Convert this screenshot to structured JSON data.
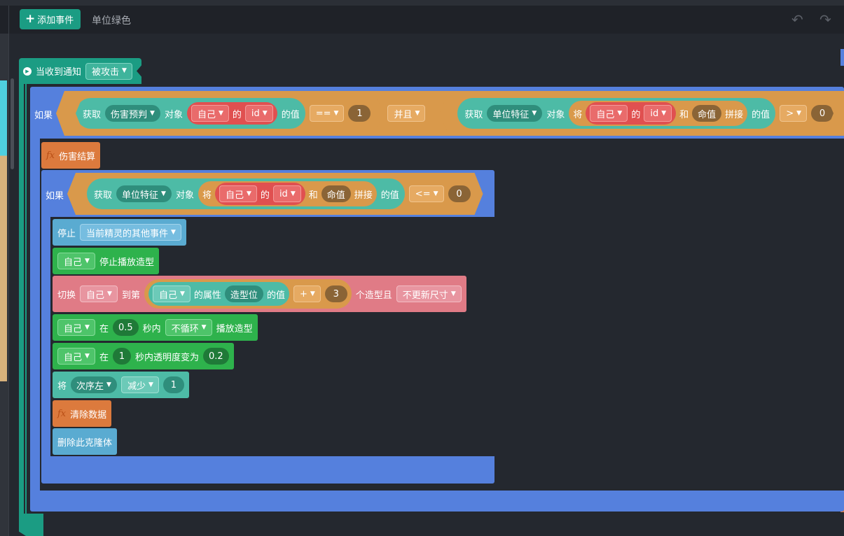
{
  "toolbar": {
    "add_event_label": "添加事件",
    "add_icon": "plus-icon",
    "tab_label": "单位绿色",
    "undo_icon": "undo-icon",
    "redo_icon": "redo-icon"
  },
  "colors": {
    "background": "#24282f",
    "toolbar": "#1f2228",
    "event_teal": "#1b9c83",
    "if_blue": "#5580dd",
    "operator_orange": "#d9994b",
    "sensing_teal": "#4dbba6",
    "self_red": "#e05050",
    "looks_green": "#2eb24c",
    "control_blue": "#5aabd1",
    "looks_pink": "#e07b86",
    "func_orange": "#dc7a3d"
  },
  "event": {
    "label": "当收到通知",
    "icon": "play-circle-icon",
    "message": "被攻击"
  },
  "if1": {
    "label": "如果",
    "get1": {
      "label": "获取",
      "prop": "伤害预判",
      "obj_label": "对象",
      "self": "自己",
      "of": "的",
      "field": "id",
      "value_label": "的值"
    },
    "cmp1": {
      "op": "==",
      "value": "1"
    },
    "and": "并且",
    "get2": {
      "label": "获取",
      "prop": "单位特征",
      "obj_label": "对象",
      "concat_prefix": "将",
      "self": "自己",
      "of": "的",
      "field": "id",
      "and": "和",
      "str": "命值",
      "concat": "拼接",
      "value_label": "的值"
    },
    "cmp2": {
      "op": ">",
      "value": "0"
    }
  },
  "func1": {
    "icon": "fx-icon",
    "label": "伤害结算"
  },
  "if2": {
    "label": "如果",
    "get": {
      "label": "获取",
      "prop": "单位特征",
      "obj_label": "对象",
      "concat_prefix": "将",
      "self": "自己",
      "of": "的",
      "field": "id",
      "and": "和",
      "str": "命值",
      "concat": "拼接",
      "value_label": "的值"
    },
    "cmp": {
      "op": "<=",
      "value": "0"
    }
  },
  "stop": {
    "label": "停止",
    "target": "当前精灵的其他事件"
  },
  "stop_anim": {
    "self": "自己",
    "label": "停止播放造型"
  },
  "switch": {
    "label": "切换",
    "self": "自己",
    "to": "到第",
    "self2": "自己",
    "attr": "的属性",
    "attr_name": "造型位",
    "value_label": "的值",
    "op": "+",
    "num": "3",
    "suffix": "个造型且",
    "mode": "不更新尺寸"
  },
  "play": {
    "self": "自己",
    "in": "在",
    "secs": "0.5",
    "secs_label": "秒内",
    "loop": "不循环",
    "label": "播放造型"
  },
  "fade": {
    "self": "自己",
    "in": "在",
    "secs": "1",
    "label": "秒内透明度变为",
    "value": "0.2"
  },
  "change": {
    "label": "将",
    "var": "次序左",
    "op": "减少",
    "value": "1"
  },
  "func2": {
    "icon": "fx-icon",
    "label": "清除数据"
  },
  "delete_clone": {
    "label": "删除此克隆体"
  }
}
